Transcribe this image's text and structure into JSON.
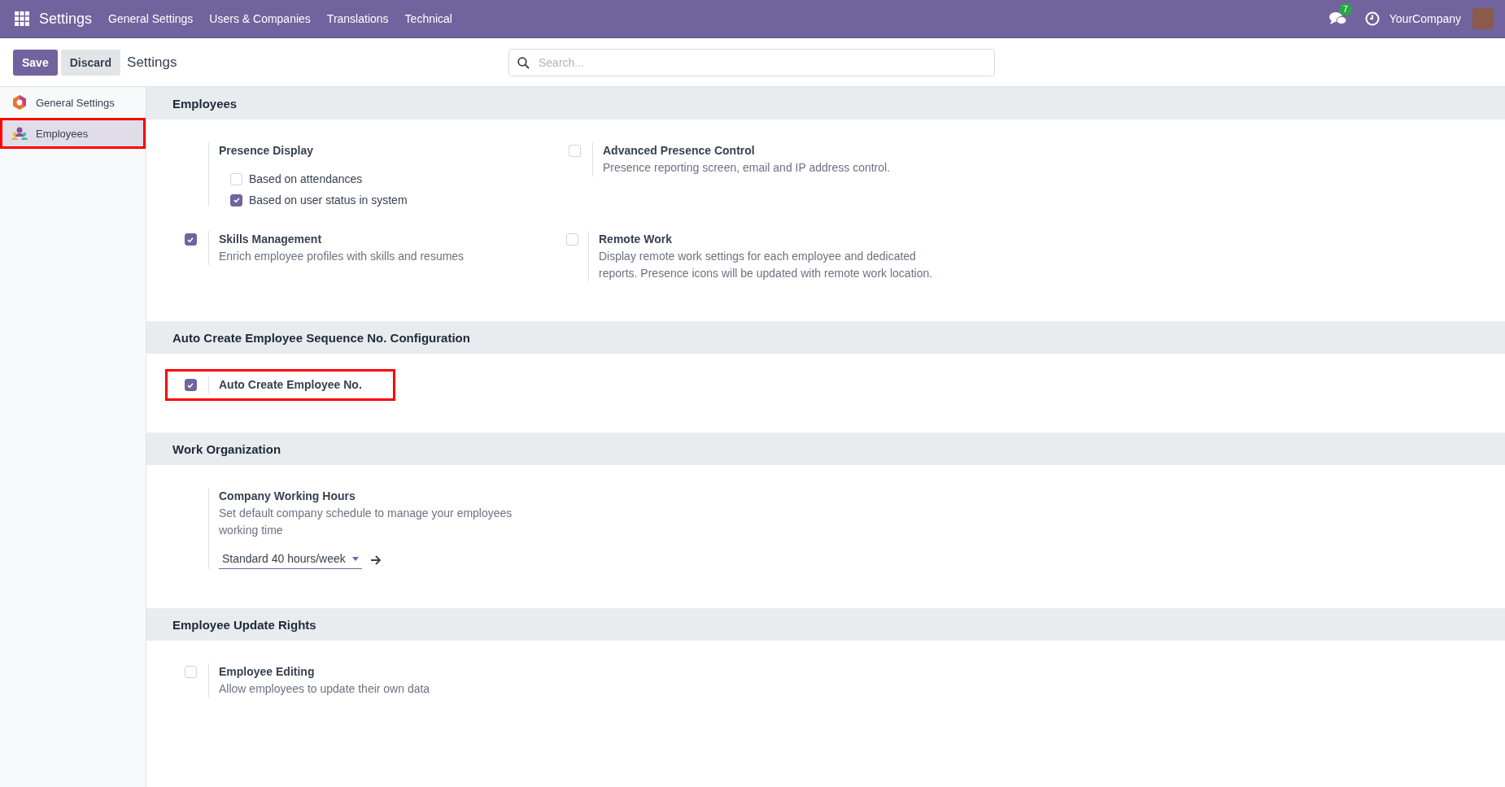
{
  "navbar": {
    "app_name": "Settings",
    "menu": [
      "General Settings",
      "Users & Companies",
      "Translations",
      "Technical"
    ],
    "messages_count": "7",
    "company": "YourCompany"
  },
  "control_panel": {
    "buttons": [
      {
        "label": "Save",
        "kind": "primary"
      },
      {
        "label": "Discard",
        "kind": "secondary"
      }
    ],
    "breadcrumb": "Settings",
    "search": {
      "placeholder": "Search..."
    }
  },
  "sidebar": {
    "items": [
      {
        "label": "General Settings",
        "selected": false,
        "highlighted": false
      },
      {
        "label": "Employees",
        "selected": true,
        "highlighted": true
      }
    ]
  },
  "sections": [
    {
      "title": "Employees",
      "settings": [
        {
          "kind": "options",
          "title": "Presence Display",
          "options": [
            {
              "label": "Based on attendances",
              "checked": false
            },
            {
              "label": "Based on user status in system",
              "checked": true
            }
          ]
        },
        {
          "kind": "toggle",
          "title": "Advanced Presence Control",
          "description": "Presence reporting screen, email and IP address control.",
          "checked": false,
          "highlighted": false
        },
        {
          "kind": "toggle",
          "title": "Skills Management",
          "description": "Enrich employee profiles with skills and resumes",
          "checked": true,
          "highlighted": false
        },
        {
          "kind": "toggle",
          "title": "Remote Work",
          "description": "Display remote work settings for each employee and dedicated reports. Presence icons will be updated with remote work location.",
          "checked": false,
          "highlighted": false
        }
      ]
    },
    {
      "title": "Auto Create Employee Sequence No. Configuration",
      "settings": [
        {
          "kind": "toggle",
          "title": "Auto Create Employee No.",
          "checked": true,
          "highlighted": true
        }
      ]
    },
    {
      "title": "Work Organization",
      "settings": [
        {
          "kind": "select",
          "title": "Company Working Hours",
          "description": "Set default company schedule to manage your employees working time",
          "value": "Standard 40 hours/week"
        }
      ]
    },
    {
      "title": "Employee Update Rights",
      "settings": [
        {
          "kind": "toggle",
          "title": "Employee Editing",
          "description": "Allow employees to update their own data",
          "checked": false,
          "highlighted": false
        }
      ]
    }
  ]
}
